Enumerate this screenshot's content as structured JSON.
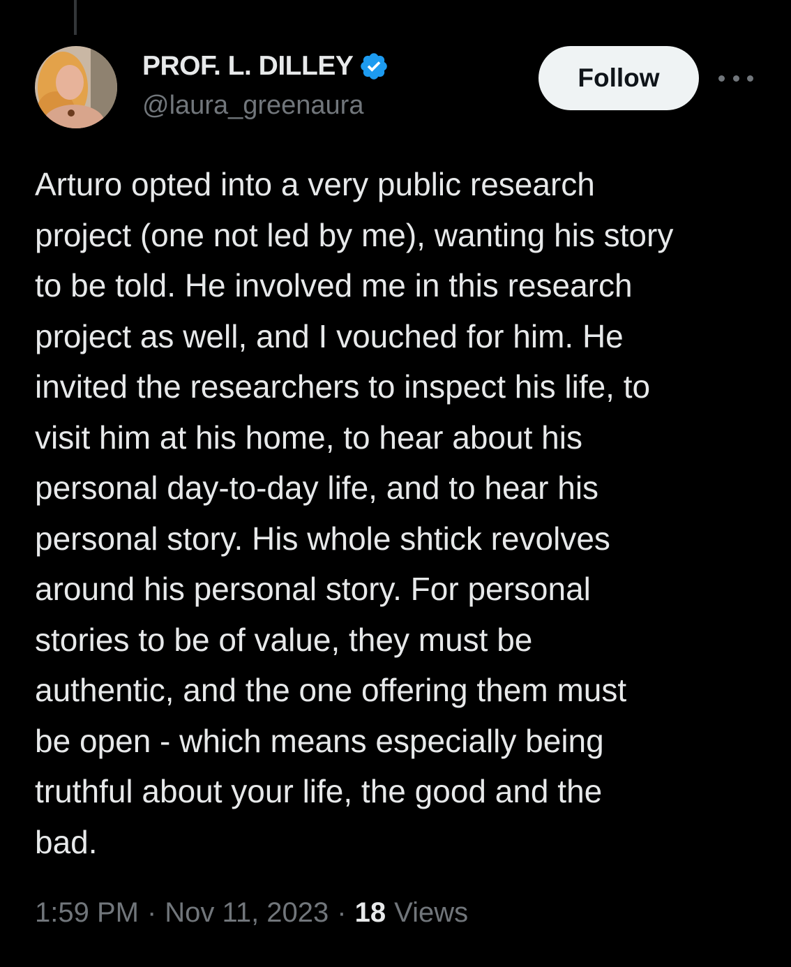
{
  "tweet": {
    "author": {
      "display_name": "PROF. L. DILLEY",
      "handle": "@laura_greenaura",
      "verified": true,
      "verified_icon": "verified-badge-icon",
      "verified_color": "#1d9bf0"
    },
    "follow_label": "Follow",
    "more_icon": "more-options-icon",
    "text": "Arturo opted into a very public research\nproject (one not led by me), wanting his story\nto be told. He involved me in this research\nproject as well, and I vouched for him. He\ninvited the researchers to inspect his life, to\nvisit him at his home, to hear about his\npersonal day-to-day life, and to hear his\npersonal story. His whole shtick revolves\naround his personal story. For personal\nstories to be of value, they must be\nauthentic, and the one offering them must\nbe open - which means especially being\ntruthful about your life, the good and the\nbad.",
    "time": "1:59 PM",
    "separator": "·",
    "date": "Nov 11, 2023",
    "views_count": "18",
    "views_label": "Views"
  },
  "colors": {
    "background": "#000000",
    "primary_text": "#e7e9ea",
    "secondary_text": "#71767b",
    "follow_bg": "#eff3f4",
    "follow_text": "#0f1419"
  }
}
